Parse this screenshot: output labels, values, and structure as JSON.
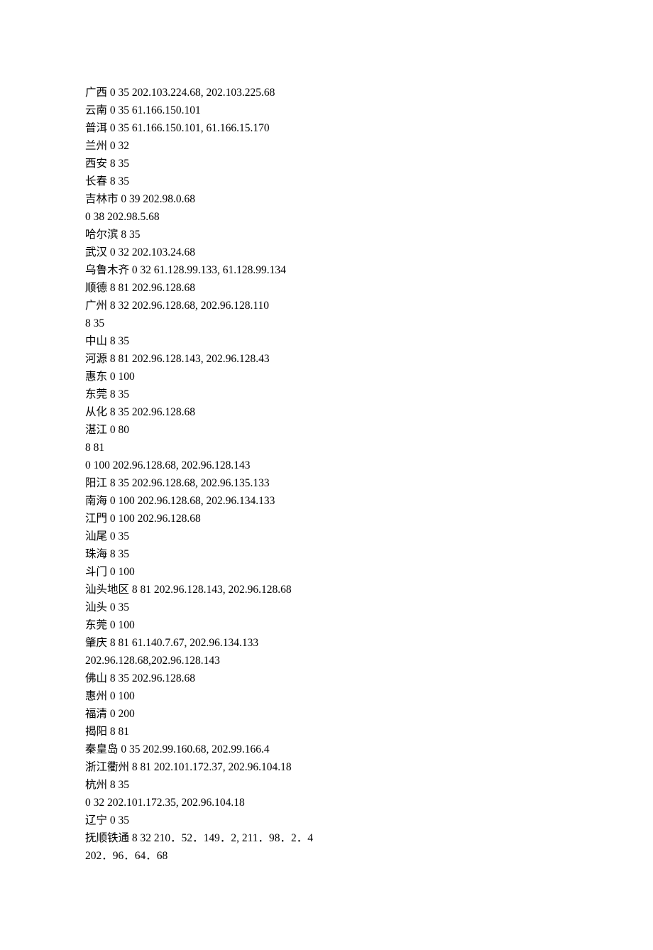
{
  "lines": [
    "广西 0 35 202.103.224.68, 202.103.225.68",
    "云南 0 35 61.166.150.101",
    "普洱 0 35 61.166.150.101, 61.166.15.170",
    "兰州 0 32",
    "西安 8 35",
    "长春 8 35",
    "吉林市 0 39 202.98.0.68",
    "0 38 202.98.5.68",
    "哈尔滨 8 35",
    "武汉 0 32 202.103.24.68",
    "乌鲁木齐 0 32 61.128.99.133, 61.128.99.134",
    "顺德 8 81 202.96.128.68",
    "广州 8 32 202.96.128.68, 202.96.128.110",
    "8 35",
    "中山 8 35",
    "河源 8 81 202.96.128.143, 202.96.128.43",
    "惠东 0 100",
    "东莞 8 35",
    "从化 8 35 202.96.128.68",
    "湛江 0 80",
    "8 81",
    "0 100 202.96.128.68, 202.96.128.143",
    "阳江 8 35 202.96.128.68, 202.96.135.133",
    "南海 0 100 202.96.128.68, 202.96.134.133",
    "江門 0 100 202.96.128.68",
    "汕尾 0 35",
    "珠海 8 35",
    "斗门 0 100",
    "汕头地区 8 81 202.96.128.143, 202.96.128.68",
    "汕头 0 35",
    "东莞 0 100",
    "肇庆 8 81 61.140.7.67, 202.96.134.133",
    "202.96.128.68,202.96.128.143",
    "佛山 8 35 202.96.128.68",
    "惠州 0 100",
    "福清 0 200",
    "揭阳 8 81",
    "秦皇岛 0 35 202.99.160.68, 202.99.166.4",
    "浙江衢州 8 81 202.101.172.37, 202.96.104.18",
    "杭州 8 35",
    "0 32 202.101.172.35, 202.96.104.18",
    "辽宁 0 35",
    "抚顺铁通 8 32 210．52．149．2, 211．98．2．4",
    "202．96．64．68"
  ]
}
